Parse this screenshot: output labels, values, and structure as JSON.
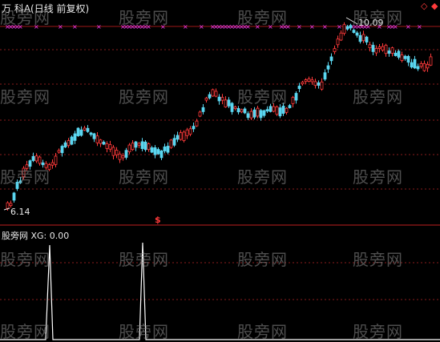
{
  "header": {
    "stock_title": "万 科A(日线 前复权)",
    "corner_icons": [
      "◇",
      "◆"
    ]
  },
  "price_chart": {
    "high_label": "10.09",
    "low_label": "6.14",
    "signal_marker": "$"
  },
  "indicator": {
    "label": "股旁网 XG: 0.00"
  },
  "watermark": "股旁网",
  "colors": {
    "up": "#ff3a3a",
    "down": "#5ad6f0",
    "grid": "#8a1c1c",
    "cross_marks": "#ff40ff",
    "indicator_line": "#ffffff"
  }
}
